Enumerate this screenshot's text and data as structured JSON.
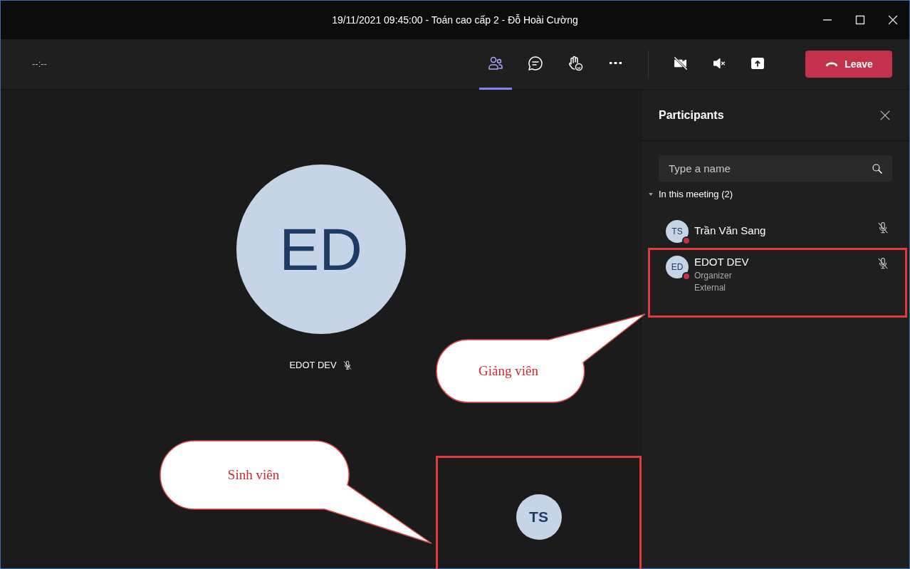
{
  "window": {
    "title": "19/11/2021 09:45:00 - Toán cao cấp 2 - Đỗ Hoài Cường"
  },
  "toolbar": {
    "timer": "--:--",
    "buttons": [
      {
        "kind": "people",
        "selected": true
      },
      {
        "kind": "chat",
        "selected": false
      },
      {
        "kind": "react",
        "selected": false
      },
      {
        "kind": "more",
        "selected": false
      }
    ],
    "device_buttons": [
      {
        "kind": "camera-off"
      },
      {
        "kind": "speaker-off"
      },
      {
        "kind": "share"
      }
    ],
    "leave_button": "Leave"
  },
  "stage": {
    "main_tile": {
      "initials": "ED",
      "name": "EDOT DEV",
      "muted": true
    },
    "small_tile": {
      "initials": "TS",
      "highlighted": true
    }
  },
  "participants_panel": {
    "title": "Participants",
    "search": {
      "placeholder": "Type a name"
    },
    "section": {
      "label": "In this meeting (2)",
      "expanded": true
    },
    "people": [
      {
        "initials": "TS",
        "name": "Trần Văn Sang",
        "color": "#c4314b",
        "muted": true,
        "highlighted": false
      },
      {
        "initials": "ED",
        "name": "EDOT DEV",
        "roles": [
          "Organizer",
          "External"
        ],
        "color": "#c4314b",
        "muted": true,
        "highlighted": true
      }
    ]
  },
  "callouts": [
    {
      "text": "Giảng viên"
    },
    {
      "text": "Sinh viên"
    }
  ]
}
